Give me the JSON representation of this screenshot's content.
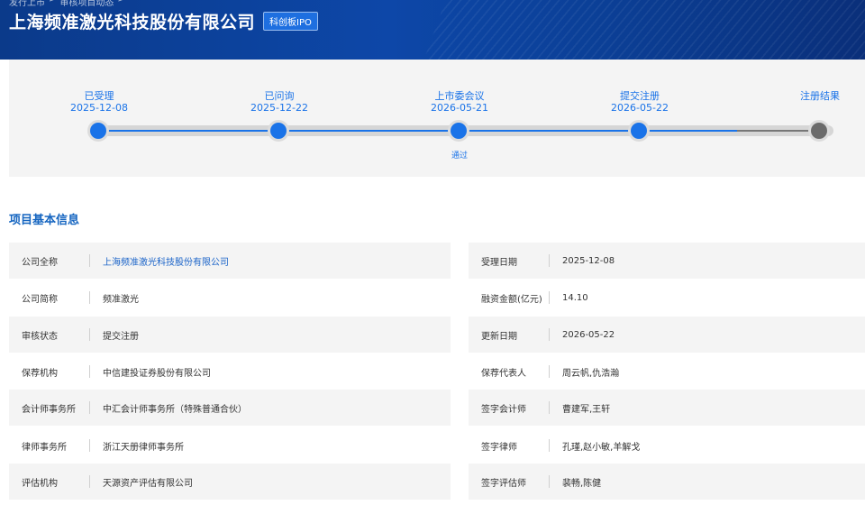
{
  "header": {
    "breadcrumb": [
      "发行上市",
      ">",
      "审核项目动态",
      ">"
    ],
    "company_title": "上海频准激光科技股份有限公司",
    "board_tag": "科创板IPO"
  },
  "timeline": {
    "steps": [
      {
        "label": "已受理",
        "date": "2025-12-08",
        "result": "",
        "done": true
      },
      {
        "label": "已问询",
        "date": "2025-12-22",
        "result": "",
        "done": true
      },
      {
        "label": "上市委会议",
        "date": "2026-05-21",
        "result": "通过",
        "done": true
      },
      {
        "label": "提交注册",
        "date": "2026-05-22",
        "result": "",
        "done": true
      },
      {
        "label": "注册结果",
        "date": "",
        "result": "",
        "done": false
      }
    ]
  },
  "section": {
    "title": "项目基本信息"
  },
  "info_left": [
    {
      "label": "公司全称",
      "value": "上海频准激光科技股份有限公司",
      "link": true
    },
    {
      "label": "公司简称",
      "value": "频准激光",
      "link": false
    },
    {
      "label": "审核状态",
      "value": "提交注册",
      "link": false
    },
    {
      "label": "保荐机构",
      "value": "中信建投证券股份有限公司",
      "link": false
    },
    {
      "label": "会计师事务所",
      "value": "中汇会计师事务所（特殊普通合伙）",
      "link": false
    },
    {
      "label": "律师事务所",
      "value": "浙江天册律师事务所",
      "link": false
    },
    {
      "label": "评估机构",
      "value": "天源资产评估有限公司",
      "link": false
    }
  ],
  "info_right": [
    {
      "label": "受理日期",
      "value": "2025-12-08"
    },
    {
      "label": "融资金额(亿元)",
      "value": "14.10"
    },
    {
      "label": "更新日期",
      "value": "2026-05-22"
    },
    {
      "label": "保荐代表人",
      "value": "周云帆,仇浩瀚"
    },
    {
      "label": "签字会计师",
      "value": "曹建军,王轩"
    },
    {
      "label": "签字律师",
      "value": "孔瑾,赵小敏,羊解戈"
    },
    {
      "label": "签字评估师",
      "value": "裴畅,陈健"
    }
  ]
}
